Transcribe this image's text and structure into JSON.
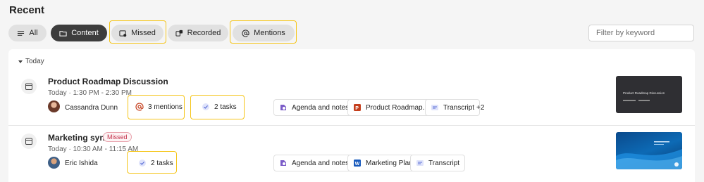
{
  "page": {
    "title": "Recent"
  },
  "filters": [
    {
      "label": "All",
      "icon": "list-icon",
      "active": false
    },
    {
      "label": "Content",
      "icon": "folder-icon",
      "active": true
    },
    {
      "label": "Missed",
      "icon": "calendar-missed-icon",
      "active": false
    },
    {
      "label": "Recorded",
      "icon": "recording-icon",
      "active": false
    },
    {
      "label": "Mentions",
      "icon": "at-icon",
      "active": false
    }
  ],
  "search": {
    "placeholder": "Filter by keyword"
  },
  "section": {
    "label": "Today"
  },
  "meetings": [
    {
      "title": "Product Roadmap Discussion",
      "badge": "",
      "time": "Today · 1:30 PM - 2:30 PM",
      "organizer": "Cassandra Dunn",
      "mentions": "3 mentions",
      "tasks": "2 tasks",
      "files": [
        "Agenda and notes",
        "Product Roadmap...",
        "Transcript"
      ],
      "more": "+2",
      "thumbnail_title": "Product Roadmap Discussion"
    },
    {
      "title": "Marketing sync",
      "badge": "Missed",
      "time": "Today · 10:30 AM - 11:15 AM",
      "organizer": "Eric Ishida",
      "tasks": "2 tasks",
      "files": [
        "Agenda and notes",
        "Marketing Plan",
        "Transcript"
      ]
    }
  ],
  "colors": {
    "highlight": "#f5c518",
    "missed": "#c4314b",
    "loop": "#7b5cc8",
    "powerpoint": "#c43e1c",
    "word": "#185abd",
    "transcript": "#5b6fd6"
  }
}
